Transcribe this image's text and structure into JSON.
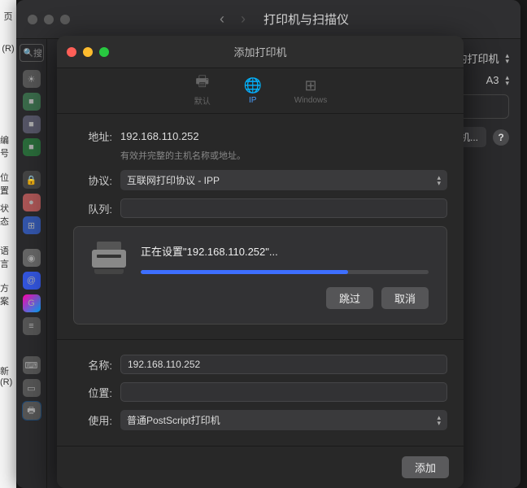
{
  "bg_window": {
    "title": "打印机与扫描仪",
    "search_placeholder": "搜",
    "right_labels": {
      "default_printer": "用的打印机",
      "paper_size": "A3",
      "add_fax": "或传真机..."
    }
  },
  "left_strip": {
    "segments": [
      "页",
      "(R)",
      "编号",
      "位置",
      "状态",
      "语言",
      "方案",
      "新(R)"
    ]
  },
  "modal": {
    "title": "添加打印机",
    "toolbar": {
      "default": "默认",
      "ip": "IP",
      "windows": "Windows"
    },
    "form": {
      "address_label": "地址:",
      "address_value": "192.168.110.252",
      "address_hint": "有效并完整的主机名称或地址。",
      "protocol_label": "协议:",
      "protocol_value": "互联网打印协议 - IPP",
      "queue_label": "队列:",
      "queue_value": ""
    },
    "progress": {
      "text_prefix": "正在设置\"",
      "text_ip": "192.168.110.252",
      "text_suffix": "\"...",
      "skip_button": "跳过",
      "cancel_button": "取消",
      "percent": 72
    },
    "bottom": {
      "name_label": "名称:",
      "name_value": "192.168.110.252",
      "location_label": "位置:",
      "location_value": "",
      "use_label": "使用:",
      "use_value": "普通PostScript打印机"
    },
    "footer": {
      "add_button": "添加"
    }
  }
}
